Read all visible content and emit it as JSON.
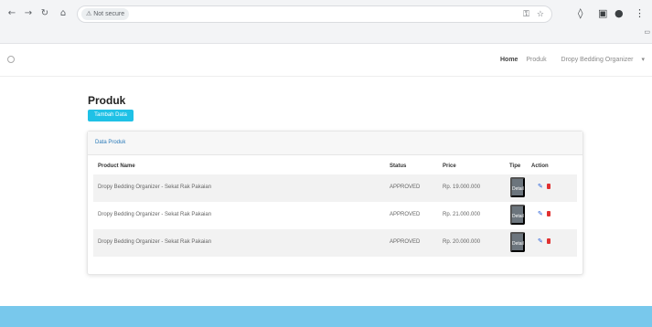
{
  "browser": {
    "security_label": "Not secure",
    "url": "",
    "bookmarks_label": ""
  },
  "navbar": {
    "brand": "",
    "links": [
      {
        "label": "Home"
      },
      {
        "label": "Produk"
      },
      {
        "label": "Dropy Bedding Organizer"
      }
    ]
  },
  "page": {
    "title": "Produk",
    "create_button": "Tambah Data"
  },
  "card": {
    "header": "Data Produk",
    "columns": [
      "Product Name",
      "Status",
      "Price",
      "Tipe",
      "Action"
    ],
    "rows": [
      {
        "name": "Dropy Bedding Organizer - Sekat Rak Pakaian",
        "status": "APPROVED",
        "price": "Rp. 19.000.000",
        "type_button": "Detail"
      },
      {
        "name": "Dropy Bedding Organizer - Sekat Rak Pakaian",
        "status": "APPROVED",
        "price": "Rp. 21.000.000",
        "type_button": "Detail"
      },
      {
        "name": "Dropy Bedding Organizer - Sekat Rak Pakaian",
        "status": "APPROVED",
        "price": "Rp. 20.000.000",
        "type_button": "Detail"
      }
    ]
  },
  "footer": {
    "text": ""
  }
}
